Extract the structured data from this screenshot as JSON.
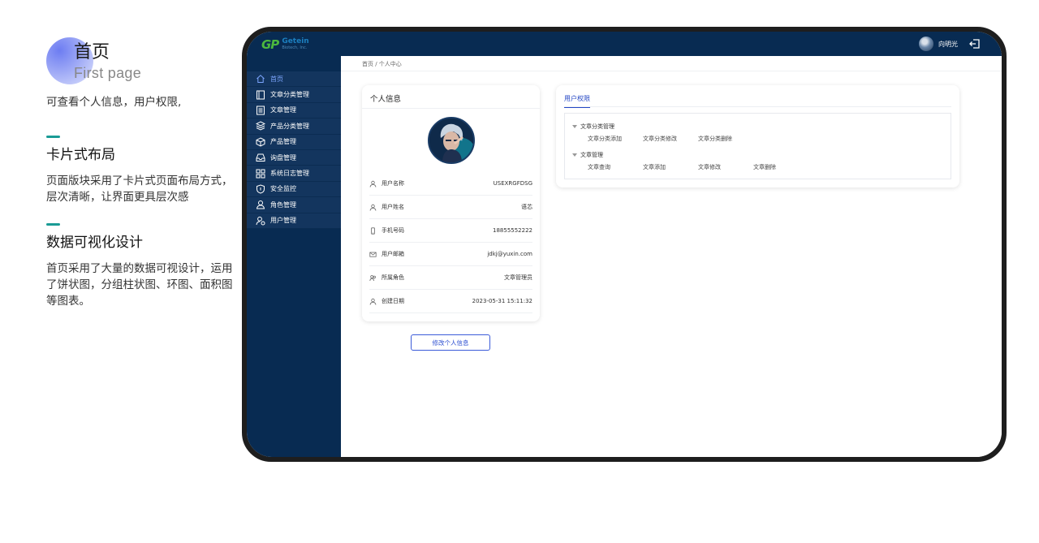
{
  "intro": {
    "title": "首页",
    "subtitle": "First page",
    "text": "可查看个人信息，用户权限,"
  },
  "sections": [
    {
      "title": "卡片式布局",
      "text": "页面版块采用了卡片式页面布局方式，层次清晰，让界面更具层次感"
    },
    {
      "title": "数据可视化设计",
      "text": "首页采用了大量的数据可视设计，运用了饼状图，分组柱状图、环图、面积图等图表。"
    }
  ],
  "app": {
    "logo": {
      "mark": "GP",
      "name": "Getein",
      "sub": "Biotech, Inc."
    },
    "user": {
      "name": "向明光"
    },
    "colors": {
      "sidebar": "#082b52",
      "accent": "#2447c4",
      "active_nav": "#7da6ff",
      "brand_green": "#4cb83e"
    },
    "breadcrumb": "首页 / 个人中心",
    "nav": [
      {
        "label": "首页",
        "icon": "home-icon",
        "active": true
      },
      {
        "label": "文章分类管理",
        "icon": "book-icon"
      },
      {
        "label": "文章管理",
        "icon": "document-icon"
      },
      {
        "label": "产品分类管理",
        "icon": "layers-icon"
      },
      {
        "label": "产品管理",
        "icon": "box-icon"
      },
      {
        "label": "询盘管理",
        "icon": "inbox-icon"
      },
      {
        "label": "系统日志管理",
        "icon": "grid-icon"
      },
      {
        "label": "安全监控",
        "icon": "shield-icon"
      },
      {
        "label": "角色管理",
        "icon": "person-icon"
      },
      {
        "label": "用户管理",
        "icon": "user-settings-icon"
      }
    ],
    "profile": {
      "title": "个人信息",
      "rows": [
        {
          "label": "用户名称",
          "value": "USEXRGFDSG",
          "icon": "user-icon"
        },
        {
          "label": "用户姓名",
          "value": "语芯",
          "icon": "user-icon"
        },
        {
          "label": "手机号码",
          "value": "18855552222",
          "icon": "phone-icon"
        },
        {
          "label": "用户邮箱",
          "value": "jdkj@yuxin.com",
          "icon": "mail-icon"
        },
        {
          "label": "所属角色",
          "value": "文章管理员",
          "icon": "group-icon"
        },
        {
          "label": "创建日期",
          "value": "2023-05-31 15:11:32",
          "icon": "user-icon"
        }
      ],
      "edit_button": "修改个人信息"
    },
    "permissions": {
      "tab": "用户权限",
      "groups": [
        {
          "name": "文章分类管理",
          "items": [
            "文章分类添加",
            "文章分类修改",
            "文章分类删除"
          ]
        },
        {
          "name": "文章管理",
          "items": [
            "文章查询",
            "文章添加",
            "文章修改",
            "文章删除"
          ]
        }
      ]
    }
  }
}
